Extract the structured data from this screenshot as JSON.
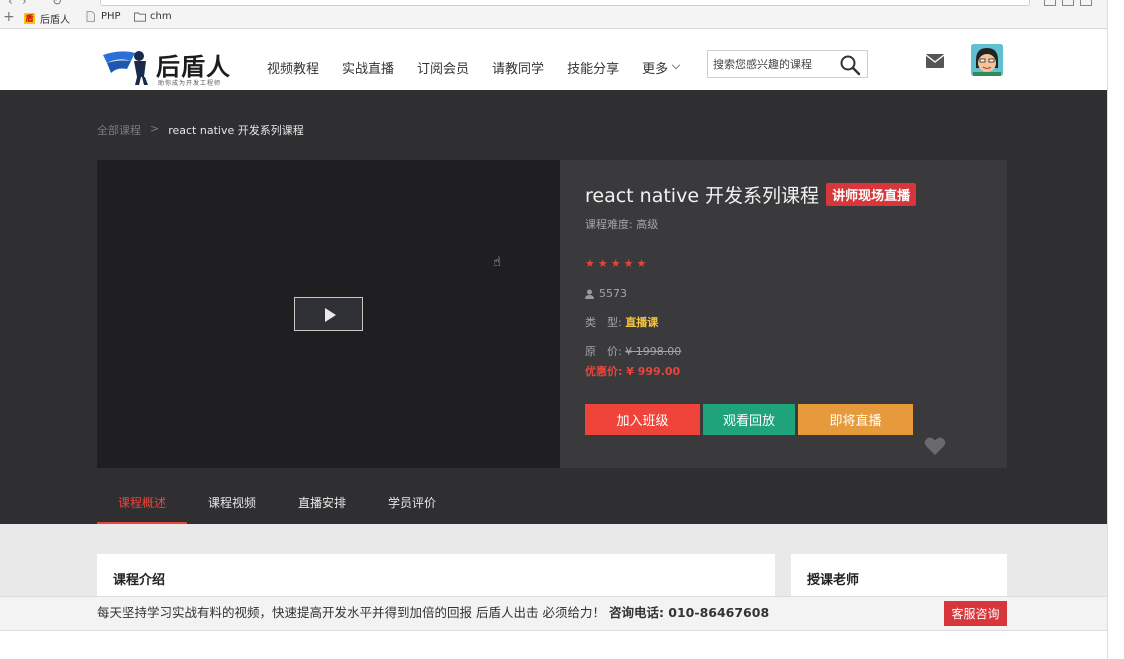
{
  "bookmarks": [
    {
      "label": "后盾人",
      "icon": "hd-favicon-icon"
    },
    {
      "label": "PHP",
      "icon": "file-icon"
    },
    {
      "label": "chm",
      "icon": "folder-icon"
    }
  ],
  "header": {
    "logo_name": "后盾人",
    "logo_tagline": "助你成为开发工程师",
    "nav": [
      "视频教程",
      "实战直播",
      "订阅会员",
      "请教同学",
      "技能分享",
      "更多"
    ],
    "search_placeholder": "搜索您感兴趣的课程"
  },
  "breadcrumb": {
    "root": "全部课程",
    "separator": ">",
    "current": "react native 开发系列课程"
  },
  "course": {
    "title": "react native 开发系列课程",
    "badge": "讲师现场直播",
    "difficulty": "课程难度: 高级",
    "rating_stars": 5,
    "students": "5573",
    "type_label": "类　型:",
    "type_value": "直播课",
    "orig_label": "原　价:",
    "orig_price": "¥ 1998.00",
    "disc_label": "优惠价:",
    "disc_price": "¥ 999.00",
    "buttons": [
      {
        "label": "加入班级",
        "color": "#f0433a"
      },
      {
        "label": "观看回放",
        "color": "#1ea37a"
      },
      {
        "label": "即将直播",
        "color": "#e69a3c"
      }
    ]
  },
  "tabs": [
    "课程概述",
    "课程视频",
    "直播安排",
    "学员评价"
  ],
  "sections": {
    "intro_title": "课程介绍",
    "teacher_title": "授课老师"
  },
  "footer": {
    "message": "每天坚持学习实战有料的视频，快速提高开发水平并得到加倍的回报 后盾人出击 必须给力！",
    "phone": "咨询电话: 010-86467608",
    "service_button": "客服咨询"
  }
}
